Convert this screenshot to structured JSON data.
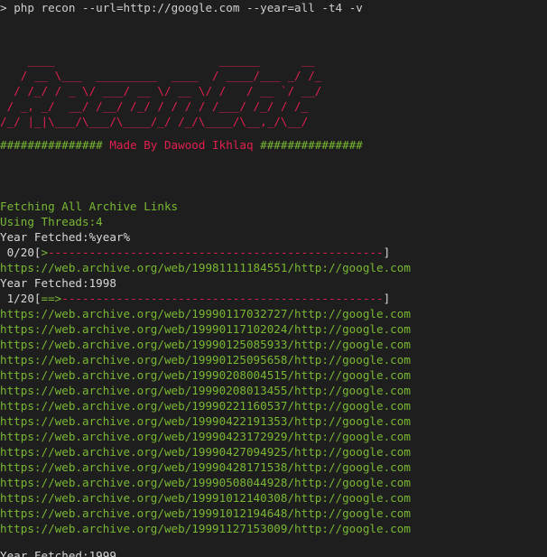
{
  "command": "php recon --url=http://google.com --year=all -t4 -v",
  "prompt_symbol": ">",
  "banner_lines": [
    "    ____                        ______      __",
    "   / __ \\___  _________  ____  / ____/___ _/ /_",
    "  / /_/ / _ \\/ ___/ __ \\/ __ \\/ /   / __ `/ __/",
    " / _, _/  __/ /__/ /_/ / / / / /___/ /_/ / /_",
    "/_/ |_|\\___/\\___/\\____/_/ /_/\\____/\\__,_/\\__/"
  ],
  "made_by": {
    "hashes_left": "###############",
    "text": " Made By Dawood Ikhlaq ",
    "hashes_right": "###############"
  },
  "status": {
    "fetching": "Fetching All Archive Links",
    "threads": "Using Threads:4",
    "year_fetched_1": "Year Fetched:%year%",
    "year_fetched_2": "Year Fetched:1998",
    "year_fetched_3": "Year Fetched:1999"
  },
  "progress": [
    {
      "label": " 0/20[",
      "arrow": ">",
      "fraction": 0.0
    },
    {
      "label": " 1/20[",
      "arrow": "==>",
      "fraction": 0.05
    }
  ],
  "progress_close": "]",
  "links_1998": [
    "https://web.archive.org/web/19981111184551/http://google.com"
  ],
  "links_1999": [
    "https://web.archive.org/web/19990117032727/http://google.com",
    "https://web.archive.org/web/19990117102024/http://google.com",
    "https://web.archive.org/web/19990125085933/http://google.com",
    "https://web.archive.org/web/19990125095658/http://google.com",
    "https://web.archive.org/web/19990208004515/http://google.com",
    "https://web.archive.org/web/19990208013455/http://google.com",
    "https://web.archive.org/web/19990221160537/http://google.com",
    "https://web.archive.org/web/19990422191353/http://google.com",
    "https://web.archive.org/web/19990423172929/http://google.com",
    "https://web.archive.org/web/19990427094925/http://google.com",
    "https://web.archive.org/web/19990428171538/http://google.com",
    "https://web.archive.org/web/19990508044928/http://google.com",
    "https://web.archive.org/web/19991012140308/http://google.com",
    "https://web.archive.org/web/19991012194648/http://google.com",
    "https://web.archive.org/web/19991127153009/http://google.com"
  ],
  "colors": {
    "background": "#1e1e1e",
    "green": "#7ab833",
    "red": "#e0204e",
    "text": "#d8d8d8"
  }
}
